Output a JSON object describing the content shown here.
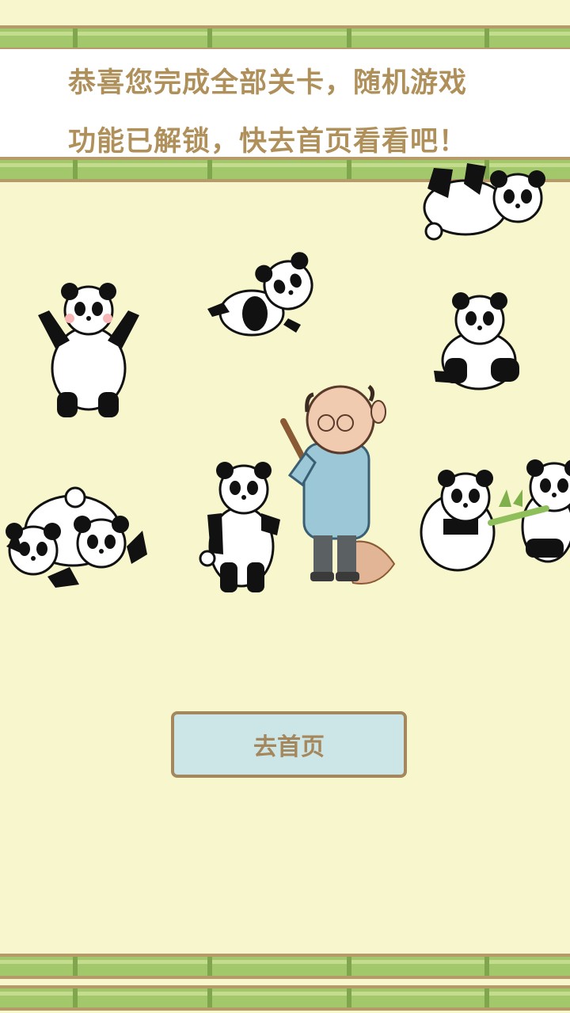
{
  "banner": {
    "line1": "恭喜您完成全部关卡，随机游戏",
    "line2": "功能已解锁，快去首页看看吧！"
  },
  "button": {
    "label": "去首页"
  },
  "colors": {
    "background": "#f8f6cc",
    "banner_bg": "#ffffff",
    "banner_text": "#b0905a",
    "bamboo": "#a3c86c",
    "bamboo_edge": "#b69b6a",
    "button_bg": "#cce5e6",
    "button_border": "#a4875c",
    "button_text": "#a4875c"
  },
  "illustration": {
    "characters": [
      "panda",
      "panda",
      "panda",
      "panda",
      "panda",
      "panda",
      "panda",
      "panda",
      "panda",
      "panda",
      "zookeeper"
    ],
    "props": [
      "broom",
      "bamboo-stick"
    ]
  }
}
